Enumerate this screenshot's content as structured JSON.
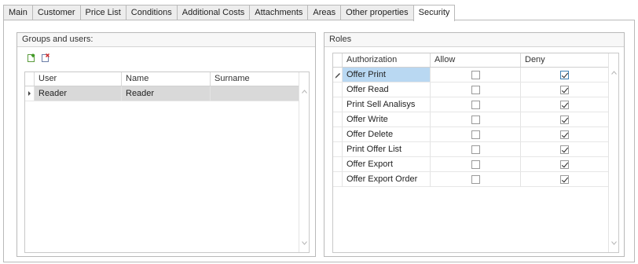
{
  "tabs": [
    "Main",
    "Customer",
    "Price List",
    "Conditions",
    "Additional Costs",
    "Attachments",
    "Areas",
    "Other properties",
    "Security"
  ],
  "active_tab": "Security",
  "groups": {
    "title": "Groups and users:",
    "toolbar": {
      "add_icon": "add-group-icon",
      "remove_icon": "remove-group-icon"
    },
    "columns": [
      "User",
      "Name",
      "Surname"
    ],
    "rows": [
      {
        "user": "Reader",
        "name": "Reader",
        "surname": ""
      }
    ]
  },
  "roles": {
    "title": "Roles",
    "columns": [
      "Authorization",
      "Allow",
      "Deny"
    ],
    "rows": [
      {
        "authorization": "Offer Print",
        "allow": false,
        "deny": true
      },
      {
        "authorization": "Offer Read",
        "allow": false,
        "deny": true
      },
      {
        "authorization": "Print Sell Analisys",
        "allow": false,
        "deny": true
      },
      {
        "authorization": "Offer Write",
        "allow": false,
        "deny": true
      },
      {
        "authorization": "Offer Delete",
        "allow": false,
        "deny": true
      },
      {
        "authorization": "Print Offer List",
        "allow": false,
        "deny": true
      },
      {
        "authorization": "Offer Export",
        "allow": false,
        "deny": true
      },
      {
        "authorization": "Offer Export Order",
        "allow": false,
        "deny": true
      }
    ]
  },
  "colors": {
    "focused_row": "#b9d8f2",
    "selected_row": "#d9d9d9",
    "border": "#b9b9b9"
  }
}
